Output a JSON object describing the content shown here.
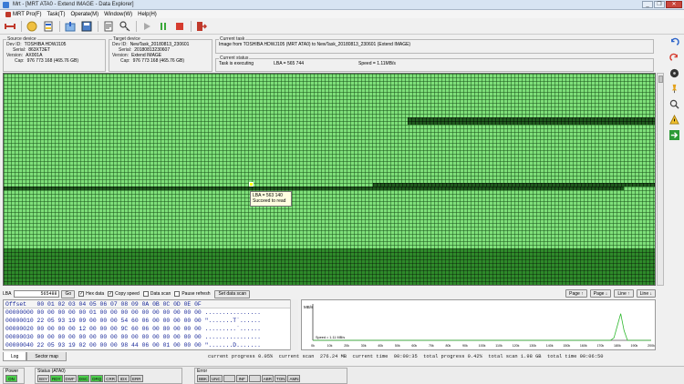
{
  "window": {
    "title": "Mrt - [MRT ATA0 - Extend IMAGE - Data Explorer]",
    "buttons": [
      "_",
      "❐",
      "✕"
    ]
  },
  "menu": [
    {
      "label": "MRT Pro(F)"
    },
    {
      "label": "Task(T)"
    },
    {
      "label": "Operate(M)"
    },
    {
      "label": "Window(W)"
    },
    {
      "label": "Help(H)"
    }
  ],
  "toolbar_icons": [
    "connect-icon",
    "disk-icon",
    "task-icon",
    "refresh-icon",
    "save-icon",
    "properties-icon",
    "key-icon",
    "play-icon",
    "pause-icon",
    "stop-icon",
    "exit-icon"
  ],
  "source": {
    "legend": "Source device",
    "rows": [
      {
        "k": "Dev ID:",
        "v": "TOSHIBA HDWJ105"
      },
      {
        "k": "Serial:",
        "v": "863XT3ET"
      },
      {
        "k": "Version:",
        "v": "AX001A"
      },
      {
        "k": "Cap:",
        "v": "976 773 168 (465.76 GB)"
      }
    ]
  },
  "target": {
    "legend": "Target device",
    "rows": [
      {
        "k": "Dev ID:",
        "v": "NewTask_20180813_230601"
      },
      {
        "k": "Serial:",
        "v": "20180813230607"
      },
      {
        "k": "Version:",
        "v": "Extend IMAGE"
      },
      {
        "k": "Cap:",
        "v": "976 773 168 (465.76 GB)"
      }
    ]
  },
  "current_task": {
    "legend": "Current task",
    "text": "Image from TOSHIBA HDWJ105 (MRT ATA0) to NewTask_20180813_230601 (Extend IMAGE)"
  },
  "current_status": {
    "legend": "Current status",
    "state": "Task is executing",
    "lba": "LBA = 565 744",
    "speed": "Speed = 1.11MB/s"
  },
  "tooltip": {
    "line1": "LBA = 563 140",
    "line2": "Succeed to read"
  },
  "controls": {
    "lba_label": "LBA",
    "lba_value": "565488",
    "go": "Go",
    "hex_data": "Hex data",
    "copy_speed": "Copy speed",
    "data_scan": "Data scan",
    "pause_refresh": "Pause refresh",
    "set_data_scan": "Set data scan",
    "page_up": "Page ↑",
    "page_down": "Page ↓",
    "line_up": "Line ↑",
    "line_down": "Line ↓"
  },
  "hex": {
    "header": "Offset   00 01 02 03 04 05 06 07 08 09 0A 0B 0C 0D 0E 0F",
    "rows": [
      "00000000 00 00 00 00 00 01 00 00 00 00 00 00 00 00 00 00 ................",
      "00000010 22 05 93 19 09 00 00 00 54 60 06 00 00 00 00 00 \".......T`......",
      "00000020 00 00 00 00 12 00 00 00 9C 60 06 00 80 00 00 00 .........`......",
      "00000030 00 00 00 00 00 00 00 00 00 00 00 00 00 00 00 00 ................",
      "00000040 22 05 93 19 02 00 00 00 98 44 06 00 01 00 00 00 \".......D......."
    ]
  },
  "chart_data": {
    "type": "line",
    "title": "",
    "xlabel": "",
    "ylabel": "MB/s",
    "legend": "Speed = 1.11 MB/s",
    "x": [
      "0k",
      "10k",
      "20k",
      "30k",
      "40k",
      "50k",
      "60k",
      "70k",
      "80k",
      "90k",
      "100k",
      "110k",
      "120k",
      "130k",
      "140k",
      "150k",
      "160k",
      "170k",
      "180k",
      "190k",
      "200k"
    ],
    "values": [
      0,
      0,
      0,
      0,
      0,
      0,
      0,
      0,
      0,
      0,
      0,
      0,
      0,
      0,
      0,
      0,
      0,
      0,
      0,
      0,
      0,
      0,
      0,
      0,
      0,
      0,
      0,
      0,
      0,
      0,
      0,
      0,
      0,
      0,
      0,
      0,
      0,
      0,
      0,
      0,
      0,
      0,
      0,
      0,
      0,
      0,
      0,
      0,
      0,
      0,
      0,
      0,
      0,
      0,
      0,
      0,
      0,
      0,
      0,
      0,
      0,
      0,
      0,
      0,
      0,
      0,
      0,
      0,
      0,
      0,
      0,
      0,
      0,
      0,
      0,
      0,
      0,
      0,
      0,
      0,
      0,
      0,
      0,
      0,
      0,
      0,
      0,
      0,
      0,
      0.1,
      0.6,
      1.1,
      0.4,
      0,
      0,
      0,
      0,
      0,
      0,
      0,
      0
    ],
    "ylim": [
      0,
      1.5
    ],
    "grid": false
  },
  "bottom": {
    "tab_log": "Log",
    "tab_sector": "Sector map",
    "progress": "current progress 0.05%  current scan  276.24 MB  current time  00:00:35  total progress 0.42%  total scan 1.98 GB  total time 00:06:50"
  },
  "status": {
    "power_label": "Power",
    "power_leds": [
      "ON"
    ],
    "status_label": "Status (ATA0)",
    "status_leds": [
      {
        "t": "BSY",
        "on": false
      },
      {
        "t": "RDY",
        "on": true
      },
      {
        "t": "DWF",
        "on": false
      },
      {
        "t": "DSC",
        "on": true
      },
      {
        "t": "DRQ",
        "on": true
      },
      {
        "t": "CRR",
        "on": false
      },
      {
        "t": "IDX",
        "on": false
      },
      {
        "t": "ERR",
        "on": false
      }
    ],
    "error_label": "Error",
    "error_leds": [
      "BBK",
      "UNC",
      "",
      "INF",
      "",
      "ABR",
      "TON",
      "AMN"
    ]
  }
}
